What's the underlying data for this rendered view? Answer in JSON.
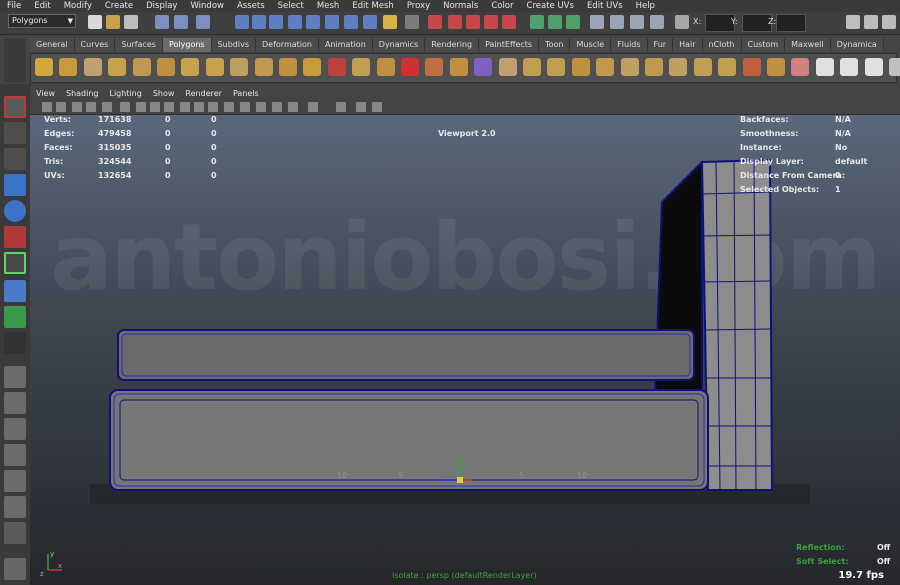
{
  "menu": [
    "File",
    "Edit",
    "Modify",
    "Create",
    "Display",
    "Window",
    "Assets",
    "Select",
    "Mesh",
    "Edit Mesh",
    "Proxy",
    "Normals",
    "Color",
    "Create UVs",
    "Edit UVs",
    "Help"
  ],
  "status": {
    "mode": "Polygons",
    "x_label": "X:",
    "y_label": "Y:",
    "z_label": "Z:"
  },
  "shelf_tabs": [
    "General",
    "Curves",
    "Surfaces",
    "Polygons",
    "Subdivs",
    "Deformation",
    "Animation",
    "Dynamics",
    "Rendering",
    "PaintEffects",
    "Toon",
    "Muscle",
    "Fluids",
    "Fur",
    "Hair",
    "nCloth",
    "Custom",
    "Maxwell",
    "Dynamica"
  ],
  "active_shelf_tab": "Polygons",
  "panel_menu": [
    "View",
    "Shading",
    "Lighting",
    "Show",
    "Renderer",
    "Panels"
  ],
  "hud_left": [
    {
      "label": "Verts:",
      "v1": "171638",
      "v2": "0",
      "v3": "0"
    },
    {
      "label": "Edges:",
      "v1": "479458",
      "v2": "0",
      "v3": "0"
    },
    {
      "label": "Faces:",
      "v1": "315035",
      "v2": "0",
      "v3": "0"
    },
    {
      "label": "Tris:",
      "v1": "324544",
      "v2": "0",
      "v3": "0"
    },
    {
      "label": "UVs:",
      "v1": "132654",
      "v2": "0",
      "v3": "0"
    }
  ],
  "hud_center": "Viewport 2.0",
  "hud_right": [
    {
      "label": "Backfaces:",
      "value": "N/A"
    },
    {
      "label": "Smoothness:",
      "value": "N/A"
    },
    {
      "label": "Instance:",
      "value": "No"
    },
    {
      "label": "Display Layer:",
      "value": "default"
    },
    {
      "label": "Distance From Camera:",
      "value": "0"
    },
    {
      "label": "Selected Objects:",
      "value": "1"
    }
  ],
  "hud_bottom_right": [
    {
      "label": "Reflection:",
      "value": "Off"
    },
    {
      "label": "Soft Select:",
      "value": "Off"
    }
  ],
  "camera_label": "Isolate : persp (defaultRenderLayer)",
  "fps": "19.7 fps",
  "watermark": "antoniobosi.com",
  "grid_labels": [
    "10",
    "5",
    "5",
    "10"
  ],
  "axis_labels": {
    "x": "x",
    "y": "y",
    "z": "z"
  },
  "colors": {
    "wire": "#10107a",
    "mesh": "#6b6b6b",
    "accent": "#3aa23a"
  }
}
